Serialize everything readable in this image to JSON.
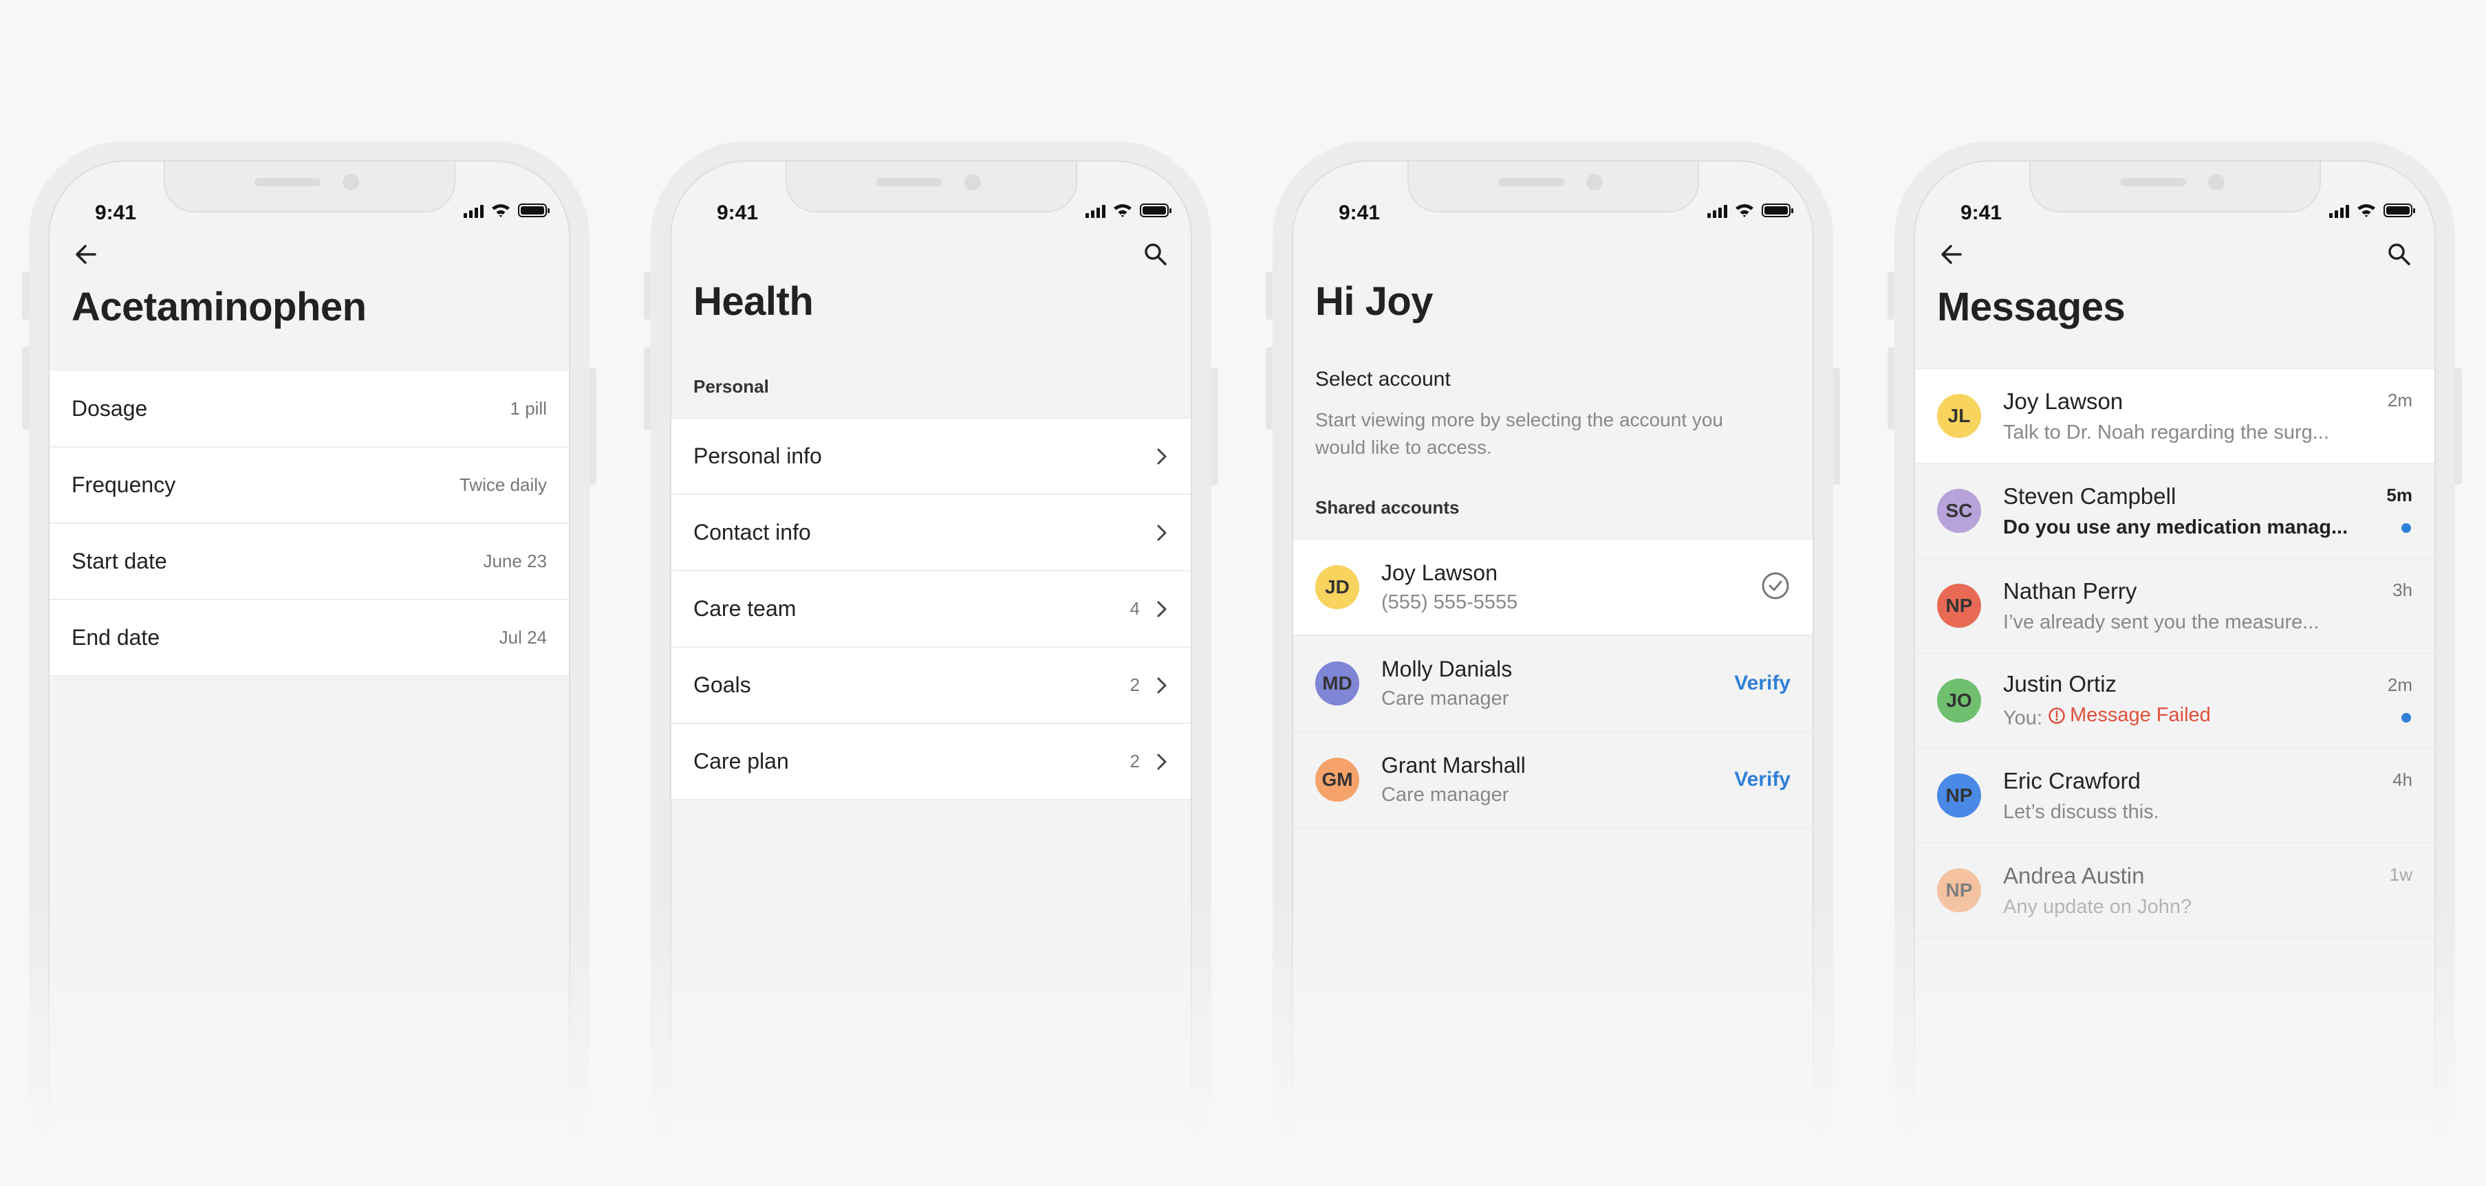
{
  "status_time": "9:41",
  "colors": {
    "accent": "#2f7fd8",
    "error": "#e0503c",
    "avatar_yellow": "#f8d35e",
    "avatar_purple": "#b7a3d9",
    "avatar_red": "#e86a55",
    "avatar_green": "#6fbf6f",
    "avatar_blue": "#4a89e6",
    "avatar_orange": "#f5a36b",
    "avatar_indigo": "#7f86d6"
  },
  "screen1": {
    "back_icon": "arrow-left-icon",
    "title": "Acetaminophen",
    "rows": [
      {
        "label": "Dosage",
        "value": "1 pill"
      },
      {
        "label": "Frequency",
        "value": "Twice daily"
      },
      {
        "label": "Start date",
        "value": "June 23"
      },
      {
        "label": "End date",
        "value": "Jul 24"
      }
    ]
  },
  "screen2": {
    "search_icon": "search-icon",
    "title": "Health",
    "section": "Personal",
    "rows": [
      {
        "label": "Personal info",
        "count": ""
      },
      {
        "label": "Contact info",
        "count": ""
      },
      {
        "label": "Care team",
        "count": "4"
      },
      {
        "label": "Goals",
        "count": "2"
      },
      {
        "label": "Care plan",
        "count": "2"
      }
    ]
  },
  "screen3": {
    "title": "Hi Joy",
    "select_heading": "Select account",
    "select_desc_line1": "Start viewing more by selecting the account you",
    "select_desc_line2": "would like to access.",
    "section": "Shared accounts",
    "accounts": [
      {
        "initials": "JD",
        "name": "Joy Lawson",
        "sub": "(555) 555-5555",
        "action": ""
      },
      {
        "initials": "MD",
        "name": "Molly Danials",
        "sub": "Care manager",
        "action": "Verify"
      },
      {
        "initials": "GM",
        "name": "Grant Marshall",
        "sub": "Care manager",
        "action": "Verify"
      }
    ]
  },
  "screen4": {
    "back_icon": "arrow-left-icon",
    "search_icon": "search-icon",
    "title": "Messages",
    "messages": [
      {
        "initials": "JL",
        "name": "Joy Lawson",
        "preview": "Talk to Dr. Noah regarding the surg...",
        "time": "2m"
      },
      {
        "initials": "SC",
        "name": "Steven Campbell",
        "preview": "Do you use any medication manag...",
        "time": "5m"
      },
      {
        "initials": "NP",
        "name": "Nathan Perry",
        "preview": "I’ve already sent you the measure...",
        "time": "3h"
      },
      {
        "initials": "JO",
        "name": "Justin Ortiz",
        "preview_prefix": "You:",
        "preview": "Message Failed",
        "time": "2m"
      },
      {
        "initials": "NP",
        "name": "Eric Crawford",
        "preview": "Let’s discuss this.",
        "time": "4h"
      },
      {
        "initials": "NP",
        "name": "Andrea Austin",
        "preview": "Any update on John?",
        "time": "1w"
      }
    ]
  }
}
